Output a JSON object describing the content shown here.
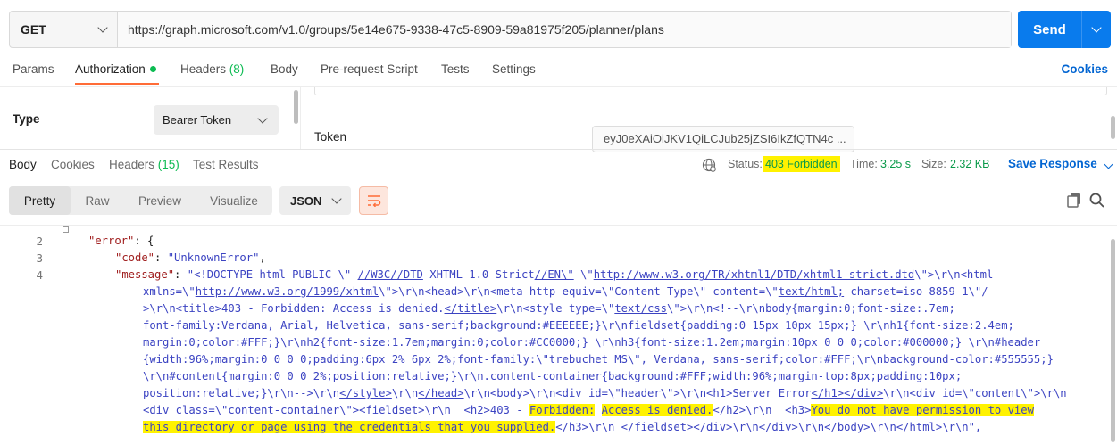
{
  "request": {
    "method": "GET",
    "url": "https://graph.microsoft.com/v1.0/groups/5e14e675-9338-47c5-8909-59a81975f205/planner/plans",
    "send_label": "Send"
  },
  "request_tabs": [
    {
      "label": "Params"
    },
    {
      "label": "Authorization"
    },
    {
      "label": "Headers ",
      "count": "(8)"
    },
    {
      "label": "Body"
    },
    {
      "label": "Pre-request Script"
    },
    {
      "label": "Tests"
    },
    {
      "label": "Settings"
    }
  ],
  "cookies_label": "Cookies",
  "auth": {
    "type_label": "Type",
    "type_value": "Bearer Token",
    "token_label": "Token",
    "token_value": "eyJ0eXAiOiJKV1QiLCJub25jZSI6IkZfQTN4c ..."
  },
  "response_tabs": [
    {
      "label": "Body"
    },
    {
      "label": "Cookies"
    },
    {
      "label": "Headers ",
      "count": "(15)"
    },
    {
      "label": "Test Results"
    }
  ],
  "status": {
    "status_label": "Status:",
    "status_value": "403 Forbidden",
    "time_label": "Time:",
    "time_value": "3.25 s",
    "size_label": "Size:",
    "size_value": "2.32 KB"
  },
  "save_response_label": "Save Response",
  "view_modes": [
    "Pretty",
    "Raw",
    "Preview",
    "Visualize"
  ],
  "format": "JSON",
  "colors": {
    "accent": "#ff6c37",
    "primary": "#097bed",
    "success": "#0cbb52",
    "highlight": "#fff200"
  },
  "code": {
    "line_numbers": [
      "2",
      "3",
      "4"
    ],
    "line2": {
      "key": "\"error\"",
      "rest": ": {"
    },
    "line3": {
      "key": "\"code\"",
      "colon": ": ",
      "val": "\"UnknownError\"",
      "end": ","
    },
    "line4": {
      "key": "\"message\"",
      "colon": ": "
    },
    "msg": {
      "p1": "\"<!DOCTYPE html PUBLIC \\\"-",
      "p1u": "//W3C//DTD",
      "p1b": " XHTML 1.0 Strict",
      "p1u2": "//EN\\\"",
      "p1c": " \\\"",
      "p1u3": "http://www.w3.org/TR/xhtml1/DTD/xhtml1-strict.dtd",
      "p1d": "\\\">\\r\\n<html",
      "p2a": "xmlns=\\\"",
      "p2u": "http://www.w3.org/1999/xhtml",
      "p2b": "\\\">\\r\\n<head>\\r\\n<meta http-equiv=\\\"Content-Type\\\" content=\\\"",
      "p2u2": "text/html;",
      "p2c": " charset=iso-8859-1\\\"/",
      "p3a": ">\\r\\n<title>403 - Forbidden: Access is denied.",
      "p3u": "</title>",
      "p3b": "\\r\\n<style type=\\\"",
      "p3u2": "text/css",
      "p3c": "\\\">\\r\\n<!--\\r\\nbody{margin:0;font-size:.7em;",
      "p4": "font-family:Verdana, Arial, Helvetica, sans-serif;background:#EEEEEE;}\\r\\nfieldset{padding:0 15px 10px 15px;} \\r\\nh1{font-size:2.4em;",
      "p5": "margin:0;color:#FFF;}\\r\\nh2{font-size:1.7em;margin:0;color:#CC0000;} \\r\\nh3{font-size:1.2em;margin:10px 0 0 0;color:#000000;} \\r\\n#header",
      "p6": "{width:96%;margin:0 0 0 0;padding:6px 2% 6px 2%;font-family:\\\"trebuchet MS\\\", Verdana, sans-serif;color:#FFF;\\r\\nbackground-color:#555555;}",
      "p7": "\\r\\n#content{margin:0 0 0 2%;position:relative;}\\r\\n.content-container{background:#FFF;width:96%;margin-top:8px;padding:10px;",
      "p8a": "position:relative;}\\r\\n-->\\r\\n",
      "p8u": "</style>",
      "p8b": "\\r\\n",
      "p8u2": "</head>",
      "p8c": "\\r\\n<body>\\r\\n<div id=\\\"header\\\">\\r\\n<h1>Server Error",
      "p8u3": "</h1>",
      "p8u4": "</div>",
      "p8d": "\\r\\n<div id=\\\"content\\\">\\r\\n",
      "p9a": "<div class=\\\"content-container\\\"><fieldset>\\r\\n  <h2>403 - ",
      "p9y1": "Forbidden:",
      "p9sp": " ",
      "p9y2": "Access is denied.",
      "p9u": "</h2>",
      "p9b": "\\r\\n  <h3>",
      "p9y3": "You do not have permission to view",
      "p10y": "this directory or page using the credentials that you supplied.",
      "p10u": "</h3>",
      "p10a": "\\r\\n ",
      "p10u2": "</fieldset>",
      "p10u3": "</div>",
      "p10b": "\\r\\n",
      "p10u4": "</div>",
      "p10c": "\\r\\n",
      "p10u5": "</body>",
      "p10d": "\\r\\n",
      "p10u6": "</html>",
      "p10e": "\\r\\n\","
    }
  }
}
